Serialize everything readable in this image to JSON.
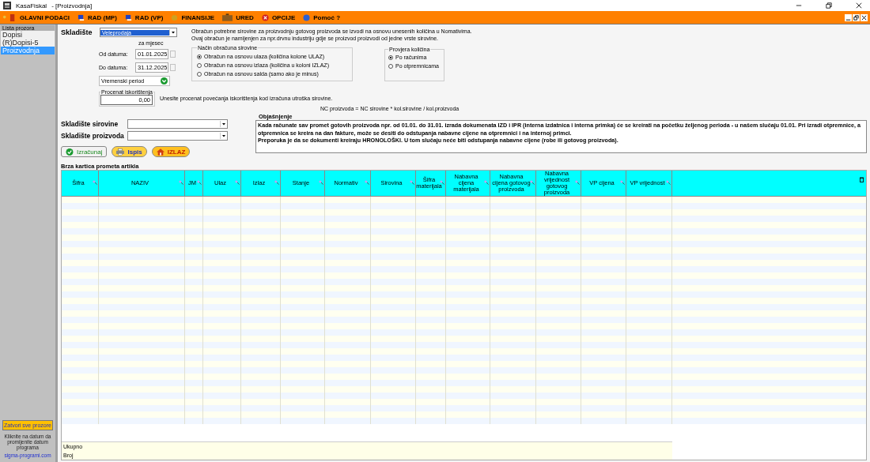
{
  "window": {
    "app": "KasaFiskal",
    "title": "- [Proizvodnja]"
  },
  "menu": [
    {
      "label": "GLAVNI PODACI",
      "kind": "keys"
    },
    {
      "label": "RAD (MP)",
      "kind": "monitor"
    },
    {
      "label": "RAD (VP)",
      "kind": "monitor"
    },
    {
      "label": "FINANSIJE",
      "kind": "coin"
    },
    {
      "label": "URED",
      "kind": "briefcase"
    },
    {
      "label": "OPCIJE",
      "kind": "stop"
    },
    {
      "label": "Pomoć ?",
      "kind": "help"
    }
  ],
  "sidebar": {
    "title": "Lista prozora",
    "items": [
      {
        "label": "Dopisi",
        "selected": false
      },
      {
        "label": "(R)Dopisi-5",
        "selected": false
      },
      {
        "label": "Proizvodnja",
        "selected": true
      }
    ],
    "close_all": "Zatvori sve prozore",
    "hint": "Kliknite na datum da promijenite datum programa",
    "link": "sigma-programi.com"
  },
  "form": {
    "warehouse_label": "Skladište",
    "warehouse": "Veleprodaja",
    "info": [
      "Obračun potrebne sirovine za proizvodnju gotovog proizvoda se izvodi na osnovu unesenih količina u Nomativima.",
      "Ovaj obračun je namijenjen za npr.drvnu industriju gdje se proizvod proizvodi od jedne vrste sirovine."
    ],
    "month_label": "za mjesec",
    "from_label": "Od datuma:",
    "from": "01.01.2025",
    "to_label": "Do datuma:",
    "to": "31.12.2025",
    "period": "Vremenski period",
    "method": {
      "title": "Način obračuna sirovine",
      "options": [
        {
          "label": "Obračun na osnovu ulaza (količina kolone ULAZ)",
          "selected": true
        },
        {
          "label": "Obračun na osnovu izlaza (količina u koloni IZLAZ)",
          "selected": false
        },
        {
          "label": "Obračun na osnovu salda (samo ako je minus)",
          "selected": false
        }
      ]
    },
    "check": {
      "title": "Provjera količina",
      "options": [
        {
          "label": "Po računima",
          "selected": true
        },
        {
          "label": "Po otpremnicama",
          "selected": false
        }
      ]
    },
    "percent_label": "Procenat iskorištenja",
    "percent": "0,00",
    "percent_hint": "Unesite procenat povećanja iskorištenja kod izračuna utroška sirovine.",
    "formula": "NC proizvoda = NC sirovine * kol.sirovine / kol.proizvoda",
    "raw_label": "Skladište sirovine",
    "product_label": "Skladište proizvoda",
    "buttons": [
      {
        "label": "Izračunaj",
        "kind": "calc"
      },
      {
        "label": "Ispis",
        "kind": "print"
      },
      {
        "label": "IZLAZ",
        "kind": "exit"
      }
    ],
    "explanation_title": "Objašnjenje",
    "explanation": "Kada računate sav promet gotovih proizvoda npr. od 01.01. do 31.01. izrada dokumenata IZD i IPR (interna izdatnica i interna primka) će se kreirati na početku željenog perioda - u našem slučaju 01.01. Pri izradi otpremnice, a otpremnica se kreira na dan fakture, može se desiti do odstupanja nabavne cijene na otpremnici i na internoj primci.\nPreporuka je da se dokumenti kreiraju HRONOLOŠKI. U tom slučaju neće biti odstupanja nabavne cijene (robe ili gotovog proizvoda)."
  },
  "table": {
    "title": "Brza kartica prometa artikla",
    "columns": [
      "Šifra",
      "NAZIV",
      "JM",
      "Ulaz",
      "Izlaz",
      "Stanje",
      "Normativ",
      "Sirovina",
      "Šifra materijala",
      "Nabavna cijena materijala",
      "Nabavna cijena gotovog proizvoda",
      "Nabavna vrijednost gotovog proizvoda",
      "VP cijena",
      "VP vrijednost"
    ],
    "footer": [
      "Ukupno",
      "Broj"
    ]
  }
}
